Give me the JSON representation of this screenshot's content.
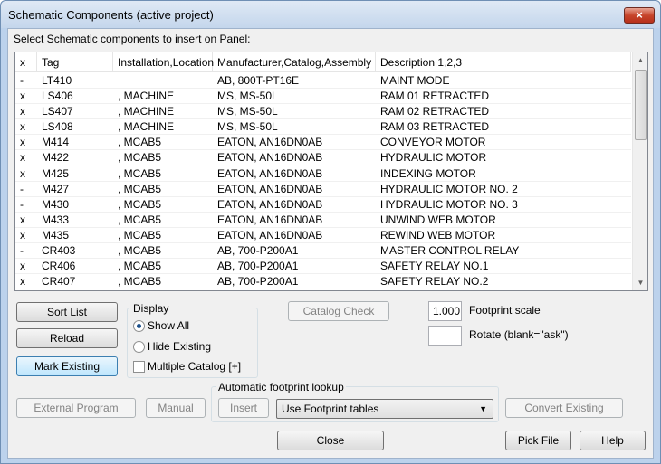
{
  "window": {
    "title": "Schematic Components (active project)",
    "close_glyph": "×"
  },
  "instruction": "Select Schematic components to insert on Panel:",
  "table": {
    "headers": [
      "x",
      "Tag",
      "Installation,Location",
      "Manufacturer,Catalog,Assembly",
      "Description 1,2,3"
    ],
    "rows": [
      [
        "-",
        "LT410",
        "",
        "AB, 800T-PT16E",
        "MAINT MODE"
      ],
      [
        "x",
        "LS406",
        ", MACHINE",
        "MS, MS-50L",
        "RAM 01 RETRACTED"
      ],
      [
        "x",
        "LS407",
        ", MACHINE",
        "MS, MS-50L",
        "RAM 02 RETRACTED"
      ],
      [
        "x",
        "LS408",
        ", MACHINE",
        "MS, MS-50L",
        "RAM 03 RETRACTED"
      ],
      [
        "x",
        "M414",
        ", MCAB5",
        "EATON, AN16DN0AB",
        "CONVEYOR MOTOR"
      ],
      [
        "x",
        "M422",
        ", MCAB5",
        "EATON, AN16DN0AB",
        "HYDRAULIC MOTOR"
      ],
      [
        "x",
        "M425",
        ", MCAB5",
        "EATON, AN16DN0AB",
        "INDEXING MOTOR"
      ],
      [
        "-",
        "M427",
        ", MCAB5",
        "EATON, AN16DN0AB",
        "HYDRAULIC MOTOR NO. 2"
      ],
      [
        "-",
        "M430",
        ", MCAB5",
        "EATON, AN16DN0AB",
        "HYDRAULIC MOTOR NO. 3"
      ],
      [
        "x",
        "M433",
        ", MCAB5",
        "EATON, AN16DN0AB",
        "UNWIND WEB MOTOR"
      ],
      [
        "x",
        "M435",
        ", MCAB5",
        "EATON, AN16DN0AB",
        "REWIND WEB MOTOR"
      ],
      [
        "-",
        "CR403",
        ", MCAB5",
        "AB, 700-P200A1",
        "MASTER CONTROL RELAY"
      ],
      [
        "x",
        "CR406",
        ", MCAB5",
        "AB, 700-P200A1",
        "SAFETY RELAY NO.1"
      ],
      [
        "x",
        "CR407",
        ", MCAB5",
        "AB, 700-P200A1",
        "SAFETY RELAY NO.2"
      ]
    ]
  },
  "buttons": {
    "sort_list": "Sort List",
    "reload": "Reload",
    "mark_existing": "Mark Existing",
    "catalog_check": "Catalog Check",
    "external_program": "External Program",
    "manual": "Manual",
    "insert": "Insert",
    "convert_existing": "Convert Existing",
    "close": "Close",
    "pick_file": "Pick File",
    "help": "Help"
  },
  "display": {
    "label": "Display",
    "show_all": "Show All",
    "hide_existing": "Hide Existing",
    "multiple_catalog": "Multiple Catalog [+]",
    "selected": "show_all",
    "multiple_catalog_checked": false
  },
  "footprint": {
    "scale_value": "1.000",
    "scale_label": "Footprint scale",
    "rotate_value": "",
    "rotate_label": "Rotate (blank=\"ask\")"
  },
  "lookup": {
    "label": "Automatic footprint lookup",
    "selected": "Use Footprint tables"
  },
  "icons": {
    "scroll_up": "▲",
    "scroll_down": "▼",
    "combo_arrow": "▼"
  }
}
